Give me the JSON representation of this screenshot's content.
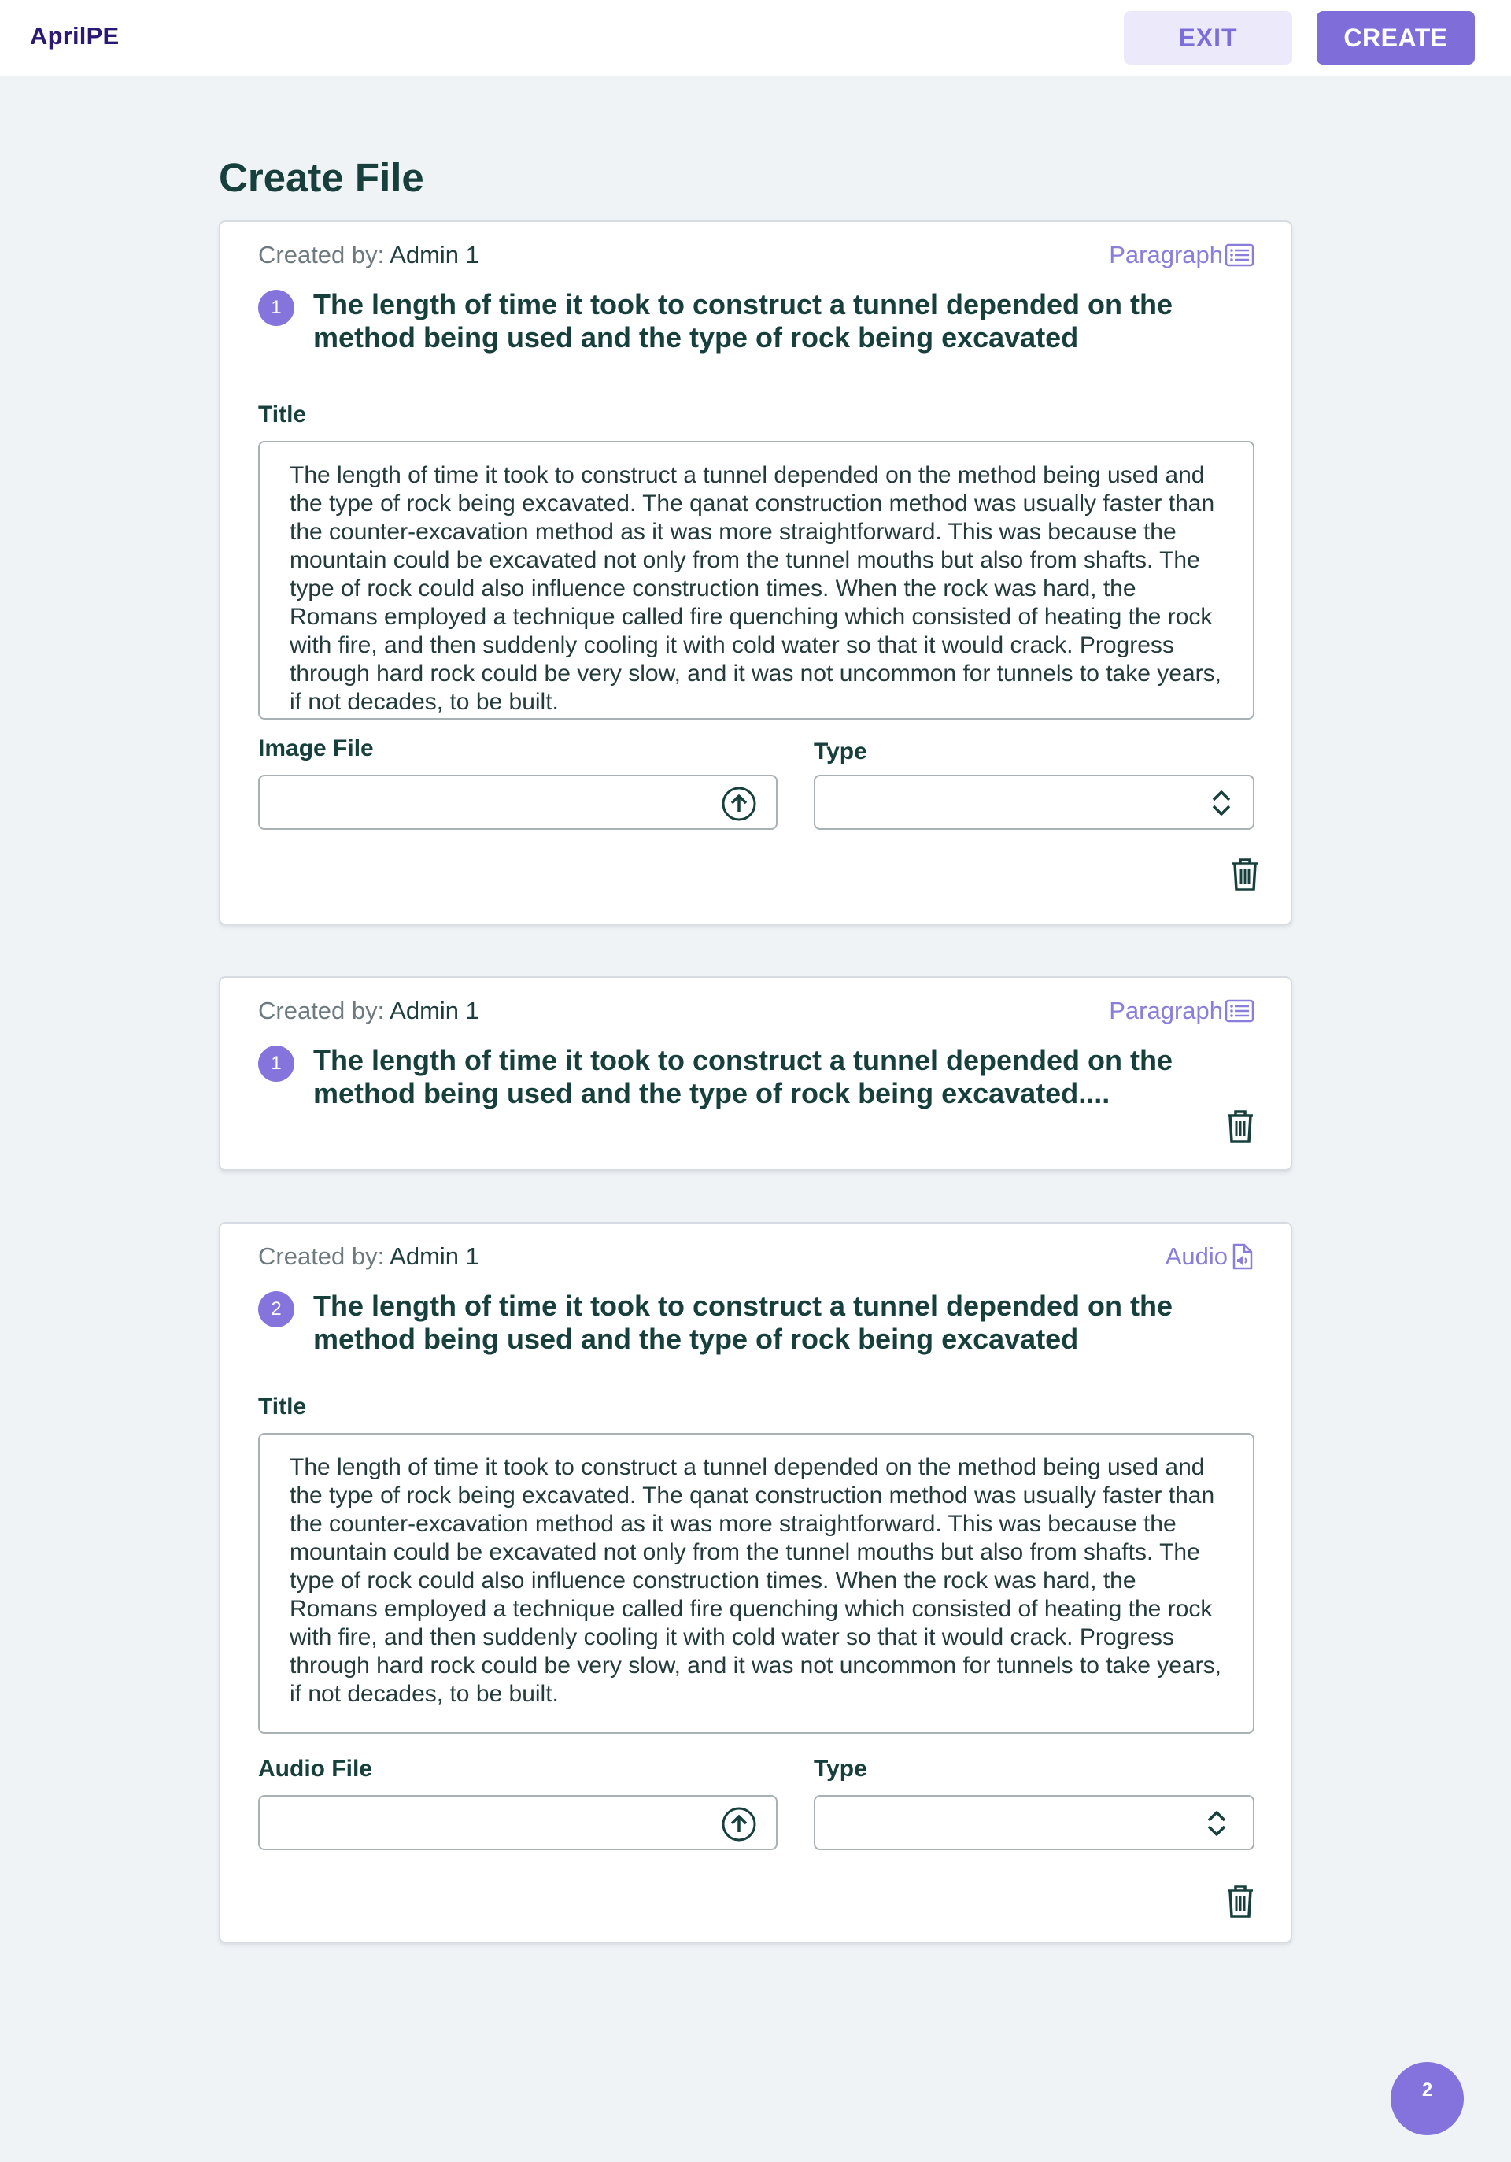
{
  "app": {
    "logo": "AprilPE"
  },
  "header": {
    "exit_label": "EXIT",
    "create_label": "CREATE"
  },
  "page": {
    "title": "Create File"
  },
  "cards": [
    {
      "created_label": "Created by:",
      "created_by": "Admin 1",
      "type_label": "Paragraph",
      "type_icon": "list-icon",
      "number": "1",
      "heading": "The length of time it took to construct a tunnel depended on the method being used and the type of rock being excavated",
      "title_label": "Title",
      "body": "The length of time it took to construct a tunnel depended on the method being used and the type of rock being excavated. The qanat construction method was usually faster than the counter-excavation method as it was more straightforward. This was because the mountain could be excavated not only from the tunnel mouths but also from shafts. The type of rock could also influence construction times. When the rock was hard, the Romans employed a technique called fire quenching which consisted of heating the rock with fire, and then suddenly cooling it with cold water so that it would crack. Progress through hard rock could be very slow, and it was not uncommon for tunnels to take years, if not decades, to be built.",
      "file_label": "Image File",
      "file_value": "",
      "type_field_label": "Type",
      "type_field_value": ""
    },
    {
      "created_label": "Created by:",
      "created_by": "Admin 1",
      "type_label": "Paragraph",
      "type_icon": "list-icon",
      "number": "1",
      "heading": "The length of time it took to construct a tunnel depended on the method being used and the type of rock being excavated...."
    },
    {
      "created_label": "Created by:",
      "created_by": "Admin 1",
      "type_label": "Audio",
      "type_icon": "audio-file-icon",
      "number": "2",
      "heading": "The length of time it took to construct a tunnel depended on the method being used and the type of rock being excavated",
      "title_label": "Title",
      "body": "The length of time it took to construct a tunnel depended on the method being used and the type of rock being excavated. The qanat construction method was usually faster than the counter-excavation method as it was more straightforward. This was because the mountain could be excavated not only from the tunnel mouths but also from shafts. The type of rock could also influence construction times. When the rock was hard, the Romans employed a technique called fire quenching which consisted of heating the rock with fire, and then suddenly cooling it with cold water so that it would crack. Progress through hard rock could be very slow, and it was not uncommon for tunnels to take years, if not decades, to be built.",
      "file_label": "Audio File",
      "file_value": "",
      "type_field_label": "Type",
      "type_field_value": ""
    }
  ],
  "fab": {
    "label": "2"
  },
  "colors": {
    "accent": "#7f6ed9",
    "accent_light": "#ece9fb",
    "text_dark": "#17403d",
    "background": "#eff3f6"
  }
}
